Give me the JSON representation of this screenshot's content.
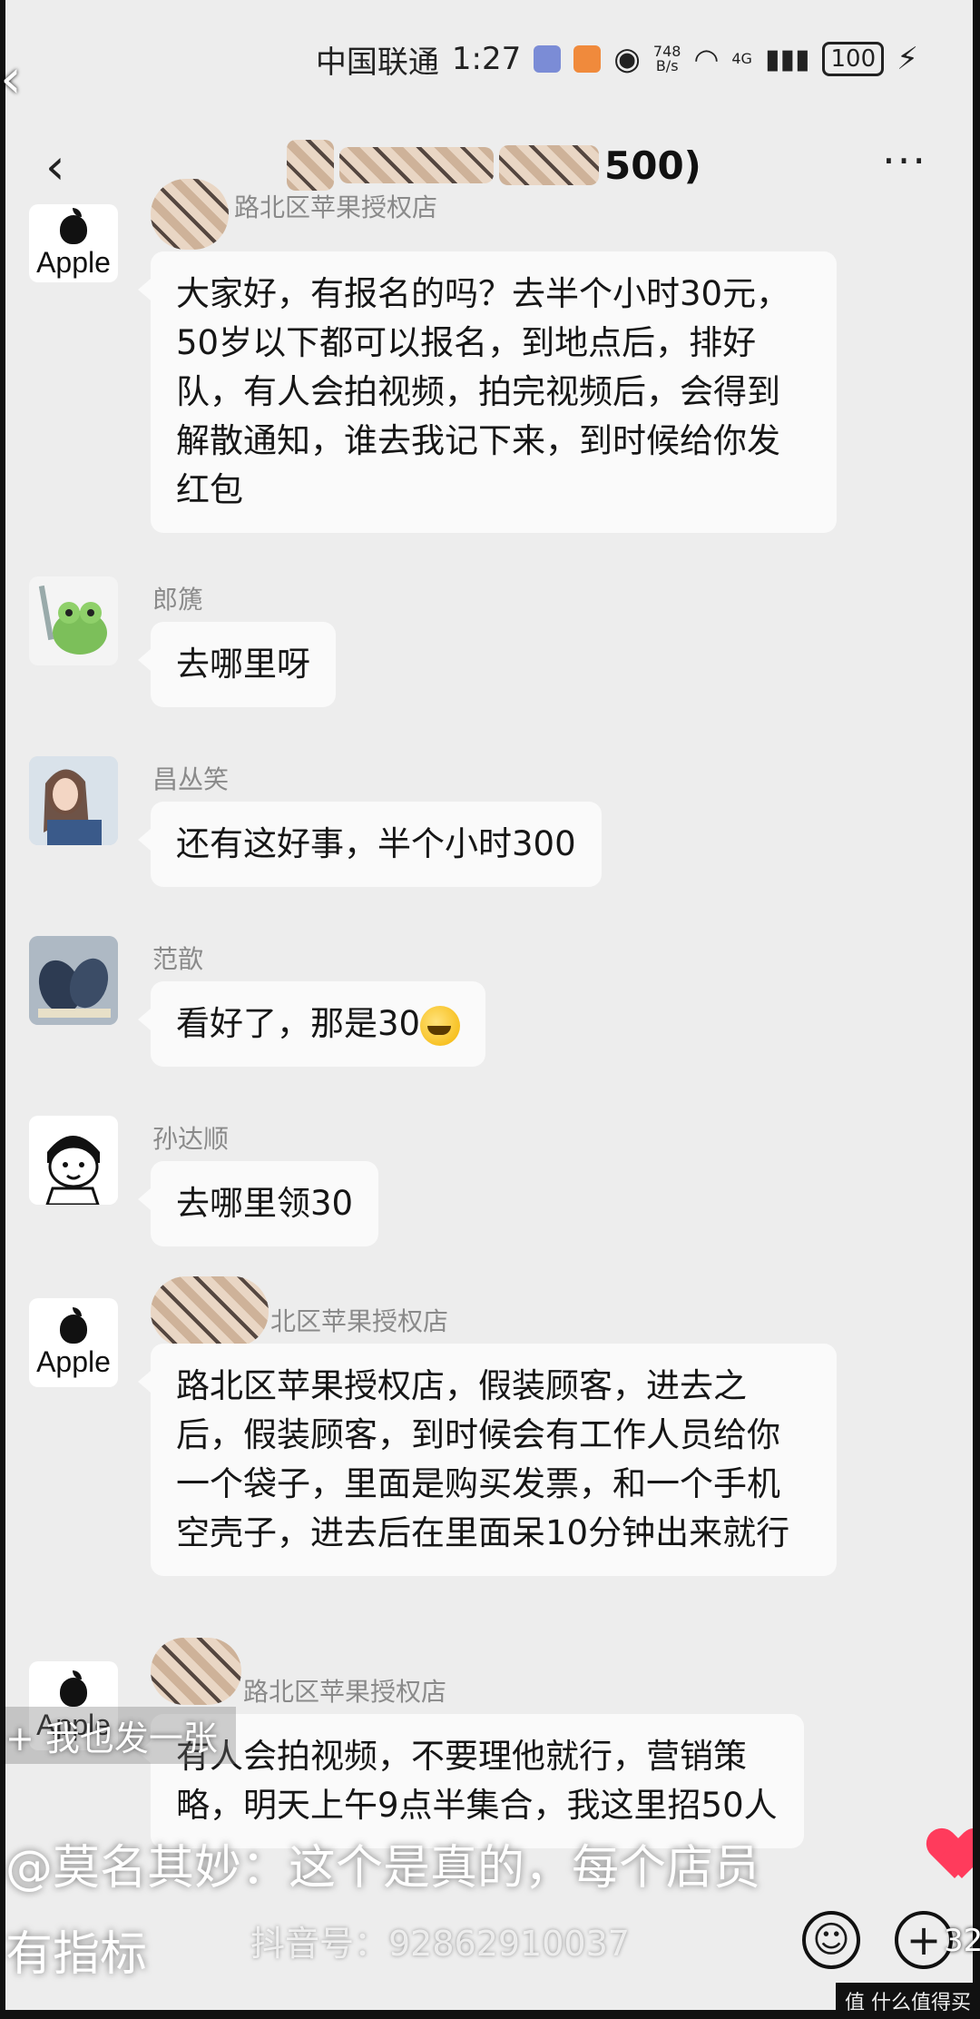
{
  "status_bar": {
    "carrier": "中国联通",
    "time": "1:27",
    "speed_value": "748",
    "speed_unit": "B/s",
    "network": "4G",
    "battery": "100"
  },
  "header": {
    "back_icon": "chevron-left-icon",
    "title_suffix": "500)",
    "more_label": "···"
  },
  "messages": [
    {
      "avatar": "apple-logo",
      "avatar_text": "Apple",
      "sender": "路北区苹果授权店",
      "text": "大家好，有报名的吗？去半个小时30元，50岁以下都可以报名，到地点后，排好队，有人会拍视频，拍完视频后，会得到解散通知，谁去我记下来，到时候给你发红包"
    },
    {
      "avatar": "frog-avatar",
      "sender": "郎篪",
      "text": "去哪里呀"
    },
    {
      "avatar": "woman-avatar",
      "sender": "昌丛笑",
      "text": "还有这好事，半个小时300"
    },
    {
      "avatar": "shoes-avatar",
      "sender": "范歆",
      "text": "看好了，那是30"
    },
    {
      "avatar": "meme-avatar",
      "sender": "孙达顺",
      "text": "去哪里领30"
    },
    {
      "avatar": "apple-logo",
      "avatar_text": "Apple",
      "sender": "北区苹果授权店",
      "text": "路北区苹果授权店，假装顾客，进去之后，假装顾客，到时候会有工作人员给你一个袋子，里面是购买发票，和一个手机空壳子，进去后在里面呆10分钟出来就行"
    },
    {
      "avatar": "apple-logo",
      "avatar_text": "Apple",
      "sender": "路北区苹果授权店",
      "text": "有人会拍视频，不要理他就行，营销策略，明天上午9点半集合，我这里招50人"
    }
  ],
  "overlay": {
    "post_button": "+ 我也发一张",
    "comment_line1": "@莫名其妙：这个是真的，每个店员",
    "comment_line2": "有指标",
    "watermark": "抖音号：92862910037",
    "like_count": "32",
    "footer_tag": "值 什么值得买"
  },
  "colors": {
    "chat_bg": "#ededed",
    "bubble_bg": "#fafafa",
    "heart": "#ff3b5c"
  }
}
